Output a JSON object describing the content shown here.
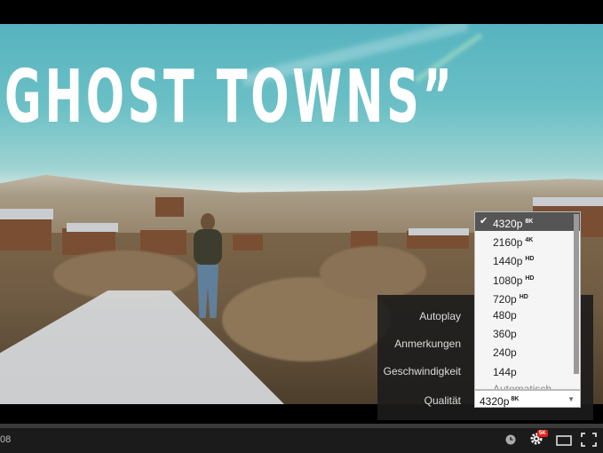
{
  "video": {
    "title_overlay": "GHOST TOWNS”"
  },
  "player": {
    "time_display": "08",
    "hd_badge": "5K",
    "settings": {
      "autoplay_label": "Autoplay",
      "annotations_label": "Anmerkungen",
      "speed_label": "Geschwindigkeit",
      "quality_label": "Qualität",
      "quality_selected": "4320p",
      "quality_selected_tag": "8K",
      "quality_options": [
        {
          "label": "4320p",
          "tag": "8K",
          "selected": true
        },
        {
          "label": "2160p",
          "tag": "4K",
          "selected": false
        },
        {
          "label": "1440p",
          "tag": "HD",
          "selected": false
        },
        {
          "label": "1080p",
          "tag": "HD",
          "selected": false
        },
        {
          "label": "720p",
          "tag": "HD",
          "selected": false
        },
        {
          "label": "480p",
          "tag": "",
          "selected": false
        },
        {
          "label": "360p",
          "tag": "",
          "selected": false
        },
        {
          "label": "240p",
          "tag": "",
          "selected": false
        },
        {
          "label": "144p",
          "tag": "",
          "selected": false
        },
        {
          "label": "Automatisch",
          "tag": "",
          "selected": false
        }
      ]
    },
    "icons": [
      "clock-icon",
      "gear-icon",
      "theater-mode-icon",
      "fullscreen-icon"
    ],
    "colors": {
      "badge": "#e62117",
      "bar": "#1b1b1b"
    }
  }
}
